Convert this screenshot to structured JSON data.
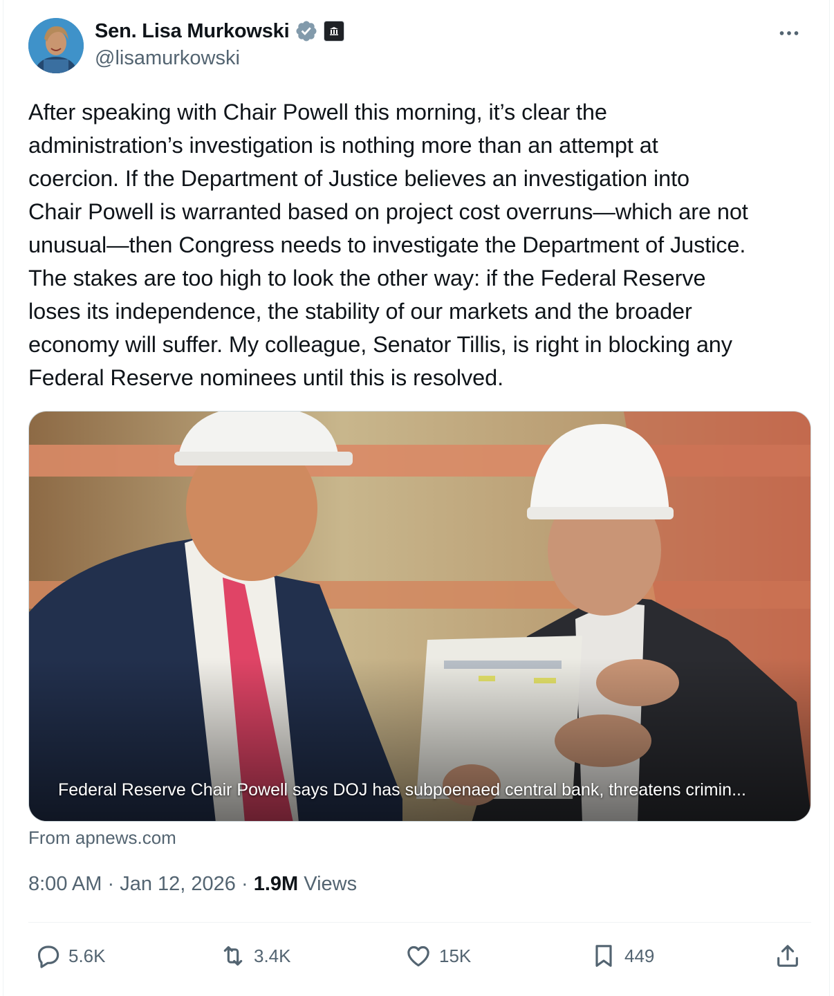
{
  "author": {
    "display_name": "Sen. Lisa Murkowski",
    "handle": "@lisamurkowski",
    "verified": true
  },
  "tweet": {
    "text": "After speaking with Chair Powell this morning, it’s clear the\nadministration’s investigation is nothing more than an attempt at\ncoercion. If the Department of Justice believes an investigation into\nChair Powell is warranted based on project cost overruns—which are not\nunusual—then Congress needs to investigate the Department of Justice.\nThe stakes are too high to look the other way: if the Federal Reserve\nloses its independence, the stability of our markets and the broader\neconomy will suffer. My colleague, Senator Tillis, is right in blocking any\nFederal Reserve nominees until this is resolved."
  },
  "link_card": {
    "headline": "Federal Reserve Chair Powell says DOJ has subpoenaed central bank, threatens crimin...",
    "source": "From apnews.com"
  },
  "meta": {
    "time": "8:00 AM",
    "date": "Jan 12, 2026",
    "views_count": "1.9M",
    "views_label": "Views",
    "sep": "·"
  },
  "actions": {
    "replies": "5.6K",
    "reposts": "3.4K",
    "likes": "15K",
    "bookmarks": "449"
  },
  "icons": [
    "verified-badge-icon",
    "government-label-icon",
    "more-icon",
    "reply-icon",
    "repost-icon",
    "like-icon",
    "bookmark-icon",
    "share-icon"
  ],
  "colors": {
    "text": "#0f1419",
    "secondary": "#536471",
    "verified_badge": "#829aab",
    "border": "#eff3f4"
  }
}
